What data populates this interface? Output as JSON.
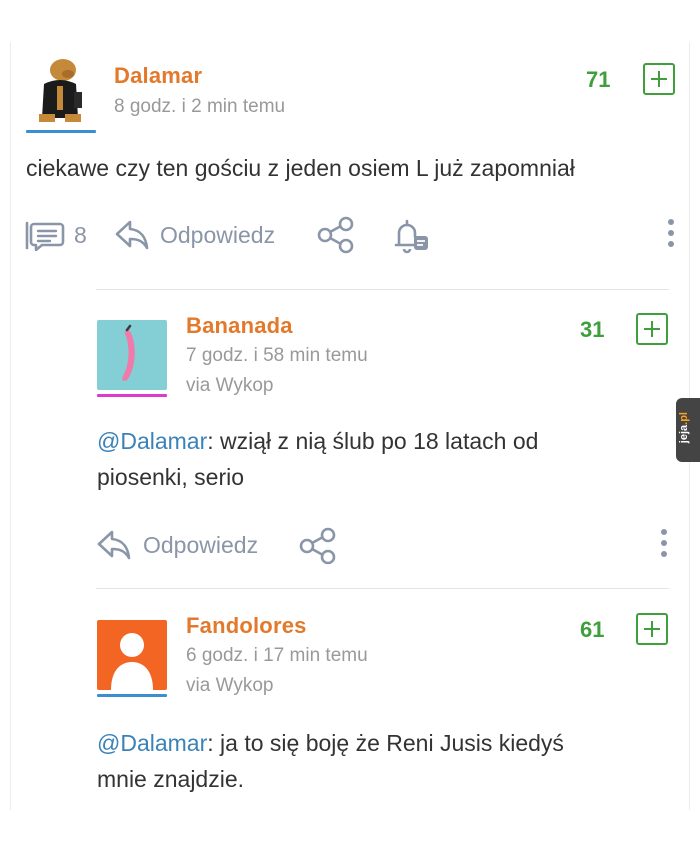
{
  "comments": [
    {
      "username": "Dalamar",
      "time": "8 godz. i 2 min temu",
      "score": "71",
      "text": "ciekawe czy ten gościu z jeden osiem L już zapomniał",
      "comments_count": "8",
      "reply_label": "Odpowiedz"
    },
    {
      "username": "Bananada",
      "time": "7 godz. i 58 min temu",
      "via": "via Wykop",
      "score": "31",
      "mention": "@Dalamar",
      "text_line1": ": wziął z nią ślub po 18 latach od",
      "text_line2": "piosenki, serio",
      "reply_label": "Odpowiedz"
    },
    {
      "username": "Fandolores",
      "time": "6 godz. i 17 min temu",
      "via": "via Wykop",
      "score": "61",
      "mention": "@Dalamar",
      "text_line1": ": ja to się boję że Reni Jusis kiedyś",
      "text_line2": "mnie znajdzie."
    }
  ],
  "watermark": {
    "part1": "jeja",
    "part2": ".pl"
  },
  "colors": {
    "username": "#e2792b",
    "score": "#3f9f3c",
    "mention": "#3b82b8",
    "action": "#8a96a8",
    "avatar_blue_underline": "#3b8fd0",
    "avatar_pink_underline": "#d93ccf"
  },
  "icons": [
    "comments-icon",
    "reply-icon",
    "share-icon",
    "bell-icon",
    "more-icon",
    "plus-icon",
    "default-avatar-icon"
  ]
}
